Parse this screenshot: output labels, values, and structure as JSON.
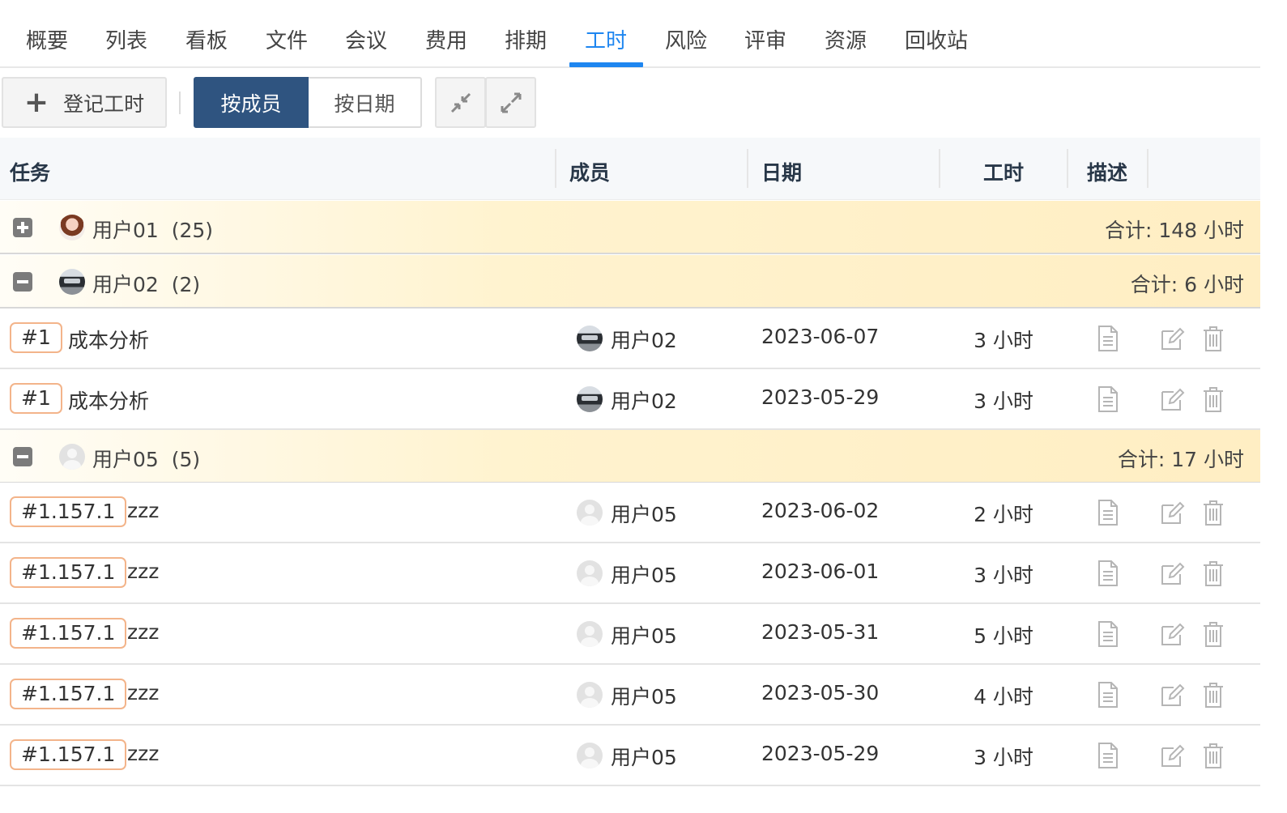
{
  "tabs": [
    "概要",
    "列表",
    "看板",
    "文件",
    "会议",
    "费用",
    "排期",
    "工时",
    "风险",
    "评审",
    "资源",
    "回收站"
  ],
  "active_tab": "工时",
  "toolbar": {
    "add_label": "登记工时",
    "add_icon": "plus-icon",
    "view_by_member": "按成员",
    "view_by_date": "按日期",
    "collapse_icon": "collapse-all-icon",
    "expand_icon": "expand-all-icon"
  },
  "colors": {
    "accent": "#1e86f0",
    "segment_active": "#2f5480",
    "group_band": "#ffeec3",
    "tag_border": "#f3b48a"
  },
  "table": {
    "headers": {
      "task": "任务",
      "member": "成员",
      "date": "日期",
      "hours": "工时",
      "desc": "描述"
    },
    "groups": [
      {
        "name": "用户01",
        "count": "(25)",
        "total": "合计: 148 小时",
        "expanded": false,
        "avatar": "girl-avatar",
        "rows": []
      },
      {
        "name": "用户02",
        "count": "(2)",
        "total": "合计: 6 小时",
        "expanded": true,
        "avatar": "car-avatar",
        "rows": [
          {
            "tag": "#1",
            "task": "成本分析",
            "member": "用户02",
            "date": "2023-06-07",
            "hours": "3 小时"
          },
          {
            "tag": "#1",
            "task": "成本分析",
            "member": "用户02",
            "date": "2023-05-29",
            "hours": "3 小时"
          }
        ]
      },
      {
        "name": "用户05",
        "count": "(5)",
        "total": "合计: 17 小时",
        "expanded": true,
        "avatar": "default-avatar",
        "rows": [
          {
            "tag": "#1.157.1",
            "task": "zzz",
            "member": "用户05",
            "date": "2023-06-02",
            "hours": "2 小时"
          },
          {
            "tag": "#1.157.1",
            "task": "zzz",
            "member": "用户05",
            "date": "2023-06-01",
            "hours": "3 小时"
          },
          {
            "tag": "#1.157.1",
            "task": "zzz",
            "member": "用户05",
            "date": "2023-05-31",
            "hours": "5 小时"
          },
          {
            "tag": "#1.157.1",
            "task": "zzz",
            "member": "用户05",
            "date": "2023-05-30",
            "hours": "4 小时"
          },
          {
            "tag": "#1.157.1",
            "task": "zzz",
            "member": "用户05",
            "date": "2023-05-29",
            "hours": "3 小时"
          }
        ]
      }
    ],
    "row_icons": [
      "description-icon",
      "edit-icon",
      "delete-icon"
    ]
  }
}
